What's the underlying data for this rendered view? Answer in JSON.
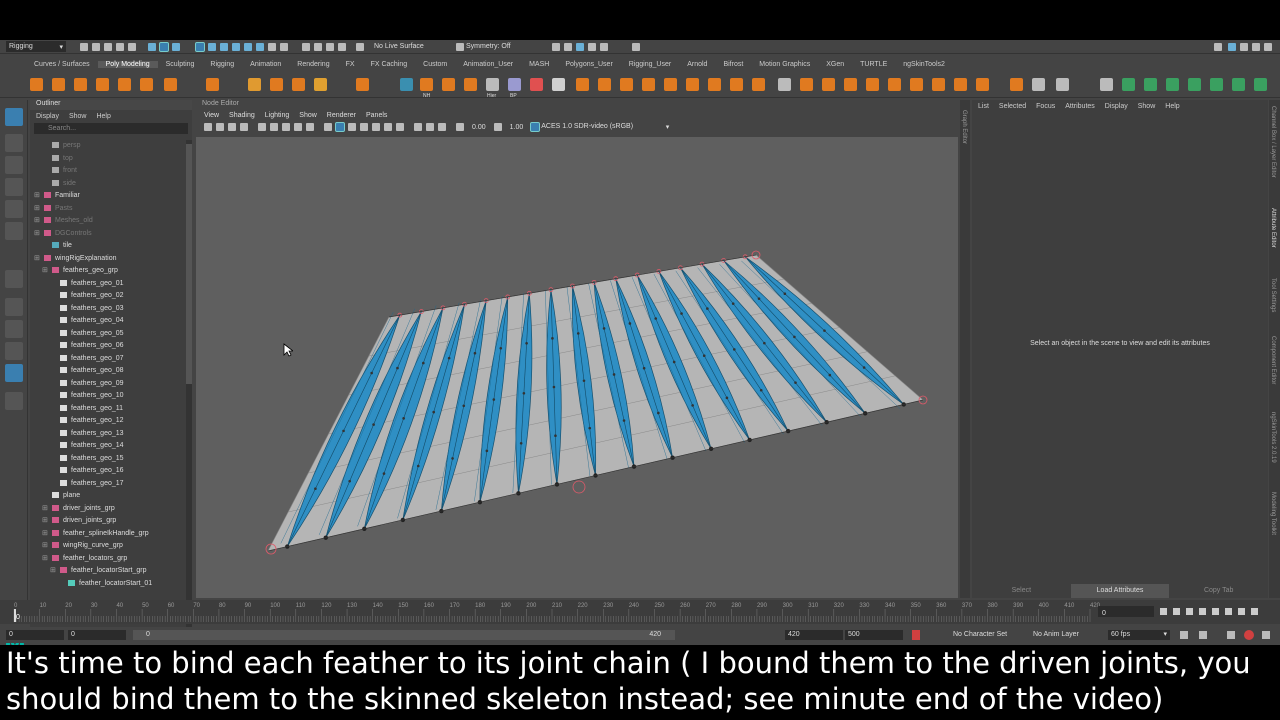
{
  "statusline": {
    "mode_menu": "Rigging",
    "live_surface": "No Live Surface",
    "symmetry": "Symmetry: Off"
  },
  "shelf_tabs": [
    "Curves / Surfaces",
    "Poly Modeling",
    "Sculpting",
    "Rigging",
    "Animation",
    "Rendering",
    "FX",
    "FX Caching",
    "Custom",
    "Animation_User",
    "MASH",
    "Polygons_User",
    "Rigging_User",
    "Arnold",
    "Bifrost",
    "Motion Graphics",
    "XGen",
    "TURTLE",
    "ngSkinTools2"
  ],
  "shelf_active": "Poly Modeling",
  "shelf_labels": {
    "nh": "NH",
    "hier": "Hier",
    "bp": "BP"
  },
  "outliner": {
    "title": "Outliner",
    "menu": [
      "Display",
      "Show",
      "Help"
    ],
    "search_placeholder": "Search...",
    "items": [
      {
        "label": "persp",
        "indent": 2,
        "dim": true,
        "icon": "camera"
      },
      {
        "label": "top",
        "indent": 2,
        "dim": true,
        "icon": "camera"
      },
      {
        "label": "front",
        "indent": 2,
        "dim": true,
        "icon": "camera"
      },
      {
        "label": "side",
        "indent": 2,
        "dim": true,
        "icon": "camera"
      },
      {
        "label": "Familiar",
        "indent": 1,
        "dim": false,
        "icon": "group"
      },
      {
        "label": "Pasts",
        "indent": 1,
        "dim": true,
        "icon": "group"
      },
      {
        "label": "Meshes_old",
        "indent": 1,
        "dim": true,
        "icon": "group"
      },
      {
        "label": "DGControls",
        "indent": 1,
        "dim": true,
        "icon": "group"
      },
      {
        "label": "tile",
        "indent": 2,
        "dim": false,
        "icon": "curve"
      },
      {
        "label": "wingRigExplanation",
        "indent": 1,
        "dim": false,
        "icon": "group"
      },
      {
        "label": "feathers_geo_grp",
        "indent": 2,
        "dim": false,
        "icon": "group"
      },
      {
        "label": "feathers_geo_01",
        "indent": 3,
        "dim": false,
        "icon": "mesh"
      },
      {
        "label": "feathers_geo_02",
        "indent": 3,
        "dim": false,
        "icon": "mesh"
      },
      {
        "label": "feathers_geo_03",
        "indent": 3,
        "dim": false,
        "icon": "mesh"
      },
      {
        "label": "feathers_geo_04",
        "indent": 3,
        "dim": false,
        "icon": "mesh"
      },
      {
        "label": "feathers_geo_05",
        "indent": 3,
        "dim": false,
        "icon": "mesh"
      },
      {
        "label": "feathers_geo_06",
        "indent": 3,
        "dim": false,
        "icon": "mesh"
      },
      {
        "label": "feathers_geo_07",
        "indent": 3,
        "dim": false,
        "icon": "mesh"
      },
      {
        "label": "feathers_geo_08",
        "indent": 3,
        "dim": false,
        "icon": "mesh"
      },
      {
        "label": "feathers_geo_09",
        "indent": 3,
        "dim": false,
        "icon": "mesh"
      },
      {
        "label": "feathers_geo_10",
        "indent": 3,
        "dim": false,
        "icon": "mesh"
      },
      {
        "label": "feathers_geo_11",
        "indent": 3,
        "dim": false,
        "icon": "mesh"
      },
      {
        "label": "feathers_geo_12",
        "indent": 3,
        "dim": false,
        "icon": "mesh"
      },
      {
        "label": "feathers_geo_13",
        "indent": 3,
        "dim": false,
        "icon": "mesh"
      },
      {
        "label": "feathers_geo_14",
        "indent": 3,
        "dim": false,
        "icon": "mesh"
      },
      {
        "label": "feathers_geo_15",
        "indent": 3,
        "dim": false,
        "icon": "mesh"
      },
      {
        "label": "feathers_geo_16",
        "indent": 3,
        "dim": false,
        "icon": "mesh"
      },
      {
        "label": "feathers_geo_17",
        "indent": 3,
        "dim": false,
        "icon": "mesh"
      },
      {
        "label": "plane",
        "indent": 2,
        "dim": false,
        "icon": "mesh"
      },
      {
        "label": "driver_joints_grp",
        "indent": 2,
        "dim": false,
        "icon": "group"
      },
      {
        "label": "driven_joints_grp",
        "indent": 2,
        "dim": false,
        "icon": "group"
      },
      {
        "label": "feather_splineIkHandle_grp",
        "indent": 2,
        "dim": false,
        "icon": "group"
      },
      {
        "label": "wingRig_curve_grp",
        "indent": 2,
        "dim": false,
        "icon": "group"
      },
      {
        "label": "feather_locators_grp",
        "indent": 2,
        "dim": false,
        "icon": "group"
      },
      {
        "label": "feather_locatorStart_grp",
        "indent": 3,
        "dim": false,
        "icon": "group"
      },
      {
        "label": "feather_locatorStart_01",
        "indent": 4,
        "dim": false,
        "icon": "locator"
      }
    ]
  },
  "viewport": {
    "panel_label": "Node Editor",
    "menu": [
      "View",
      "Shading",
      "Lighting",
      "Show",
      "Renderer",
      "Panels"
    ],
    "exposure": "0.00",
    "gamma": "1.00",
    "colorspace": "ACES 1.0 SDR-video (sRGB)"
  },
  "graph_editor_tab": "Graph Editor",
  "attribute_editor": {
    "menu": [
      "List",
      "Selected",
      "Focus",
      "Attributes",
      "Display",
      "Show",
      "Help"
    ],
    "message": "Select an object in the scene to view and edit its attributes",
    "buttons": [
      "Select",
      "Load Attributes",
      "Copy Tab"
    ]
  },
  "side_tabs": [
    "Channel Box / Layer Editor",
    "Attribute Editor",
    "Tool Settings",
    "Component Editor",
    "ngSkinTools 2.0.19",
    "Modeling Toolkit"
  ],
  "timeline": {
    "ticks": [
      "0",
      "10",
      "20",
      "30",
      "40",
      "50",
      "60",
      "70",
      "80",
      "90",
      "100",
      "110",
      "120",
      "130",
      "140",
      "150",
      "160",
      "170",
      "180",
      "190",
      "200",
      "210",
      "220",
      "230",
      "240",
      "250",
      "260",
      "270",
      "280",
      "290",
      "300",
      "310",
      "320",
      "330",
      "340",
      "350",
      "360",
      "370",
      "380",
      "390",
      "400",
      "410",
      "420"
    ],
    "current_frame": "0"
  },
  "range": {
    "start": "0",
    "anim_start": "0",
    "slider_start": "0",
    "slider_end": "420",
    "end": "420",
    "anim_end": "500",
    "char_set": "No Character Set",
    "anim_layer": "No Anim Layer",
    "fps": "60 fps"
  },
  "subtitle": {
    "line1": "It's time to bind each feather to its joint chain ( I bound them to the driven joints, you",
    "line2": "should bind them to the skinned skeleton instead; see minute end of the video)"
  },
  "colors": {
    "feather": "#2f8fc4",
    "plane": "#b5b5b5",
    "joint": "#e05a6a",
    "maya_logo": "#00b8a9"
  }
}
